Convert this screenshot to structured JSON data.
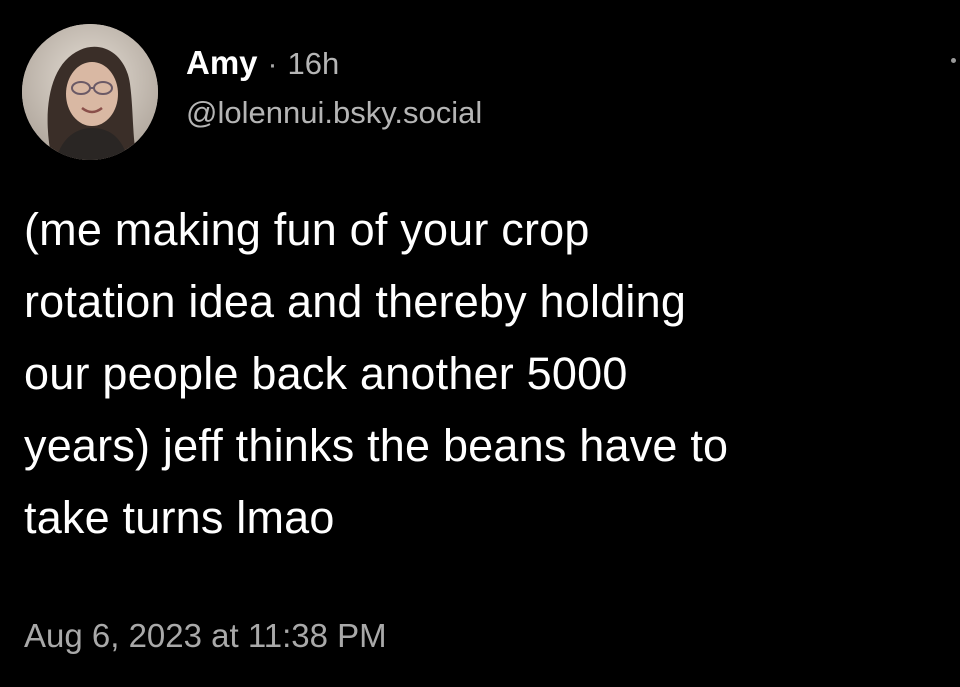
{
  "post": {
    "author_name": "Amy",
    "separator": "·",
    "relative_time": "16h",
    "handle": "@lolennui.bsky.social",
    "body_lines": [
      "(me making fun of your crop",
      "rotation idea and thereby holding",
      "our people back another 5000",
      "years) jeff thinks the beans have to",
      "take turns lmao"
    ],
    "timestamp": "Aug 6, 2023 at 11:38 PM"
  },
  "icons": {
    "avatar": "user-avatar-photo",
    "more": "more-options-icon"
  },
  "colors": {
    "background": "#000000",
    "primary_text": "#ffffff",
    "secondary_text": "#b5b5b5"
  }
}
